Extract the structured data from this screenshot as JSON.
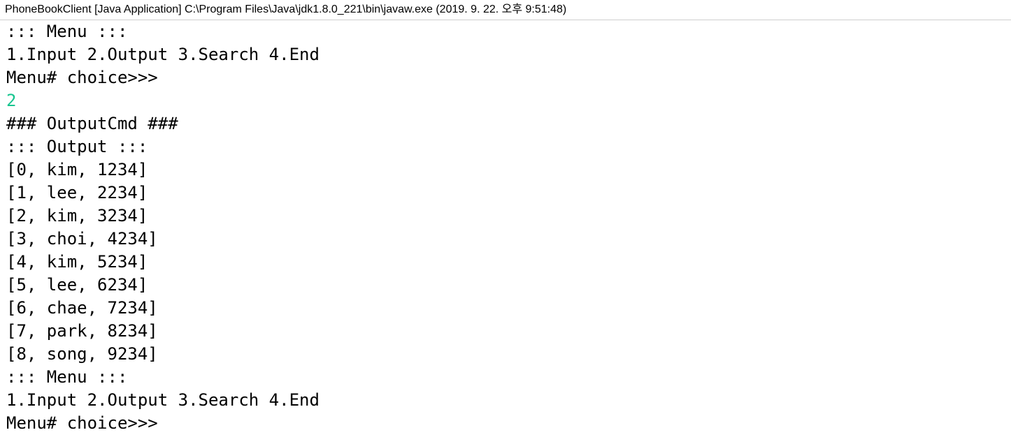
{
  "window": {
    "title": "PhoneBookClient [Java Application] C:\\Program Files\\Java\\jdk1.8.0_221\\bin\\javaw.exe (2019. 9. 22. 오후 9:51:48)"
  },
  "colors": {
    "output_text": "#000000",
    "user_input_text": "#17c58f",
    "background": "#ffffff"
  },
  "console": {
    "lines": [
      {
        "text": "::: Menu :::",
        "kind": "output"
      },
      {
        "text": "1.Input 2.Output 3.Search 4.End",
        "kind": "output"
      },
      {
        "text": "Menu# choice>>>",
        "kind": "output"
      },
      {
        "text": "2",
        "kind": "input"
      },
      {
        "text": "### OutputCmd ###",
        "kind": "output"
      },
      {
        "text": "::: Output :::",
        "kind": "output"
      },
      {
        "text": "[0, kim, 1234]",
        "kind": "output"
      },
      {
        "text": "[1, lee, 2234]",
        "kind": "output"
      },
      {
        "text": "[2, kim, 3234]",
        "kind": "output"
      },
      {
        "text": "[3, choi, 4234]",
        "kind": "output"
      },
      {
        "text": "[4, kim, 5234]",
        "kind": "output"
      },
      {
        "text": "[5, lee, 6234]",
        "kind": "output"
      },
      {
        "text": "[6, chae, 7234]",
        "kind": "output"
      },
      {
        "text": "[7, park, 8234]",
        "kind": "output"
      },
      {
        "text": "[8, song, 9234]",
        "kind": "output"
      },
      {
        "text": "::: Menu :::",
        "kind": "output"
      },
      {
        "text": "1.Input 2.Output 3.Search 4.End",
        "kind": "output"
      },
      {
        "text": "Menu# choice>>>",
        "kind": "output"
      }
    ]
  }
}
